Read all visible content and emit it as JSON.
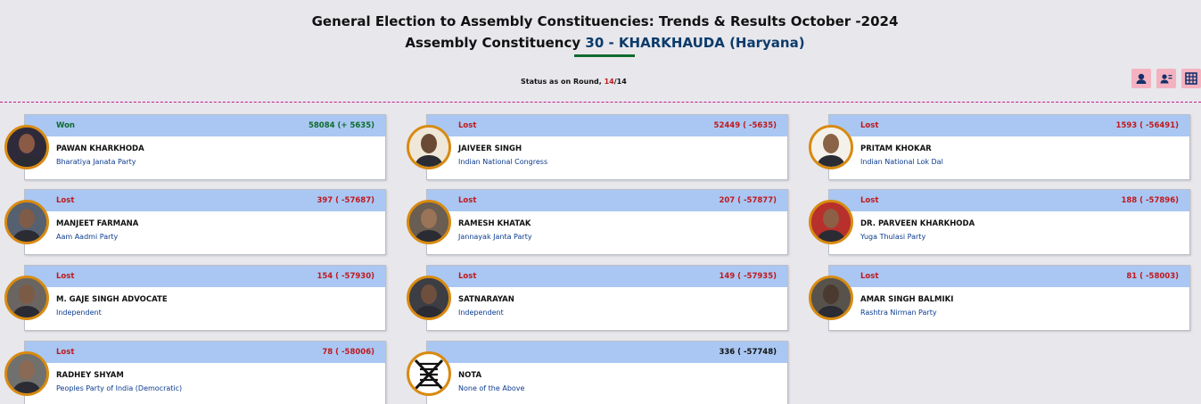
{
  "header": {
    "title_line1": "General Election to Assembly Constituencies: Trends & Results October -2024",
    "title_prefix": "Assembly Constituency ",
    "constituency": "30 - KHARKHAUDA",
    "state": "(Haryana)"
  },
  "status": {
    "label": "Status as on Round, ",
    "current_round": "14",
    "separator": "/",
    "total_rounds": "14"
  },
  "toolbar": {
    "icons": [
      "candidate-photo-icon",
      "person-list-icon",
      "table-grid-icon"
    ]
  },
  "candidates": [
    {
      "result": "Won",
      "votes": "58084 (+ 5635)",
      "name": "PAWAN KHARKHODA",
      "party": "Bharatiya Janata Party"
    },
    {
      "result": "Lost",
      "votes": "52449 ( -5635)",
      "name": "JAIVEER SINGH",
      "party": "Indian National Congress"
    },
    {
      "result": "Lost",
      "votes": "1593 ( -56491)",
      "name": "PRITAM KHOKAR",
      "party": "Indian National Lok Dal"
    },
    {
      "result": "Lost",
      "votes": "397 ( -57687)",
      "name": "MANJEET FARMANA",
      "party": "Aam Aadmi Party"
    },
    {
      "result": "Lost",
      "votes": "207 ( -57877)",
      "name": "RAMESH KHATAK",
      "party": "Jannayak Janta Party"
    },
    {
      "result": "Lost",
      "votes": "188 ( -57896)",
      "name": "DR. PARVEEN KHARKHODA",
      "party": "Yuga Thulasi Party"
    },
    {
      "result": "Lost",
      "votes": "154 ( -57930)",
      "name": "M. GAJE SINGH ADVOCATE",
      "party": "Independent"
    },
    {
      "result": "Lost",
      "votes": "149 ( -57935)",
      "name": "SATNARAYAN",
      "party": "Independent"
    },
    {
      "result": "Lost",
      "votes": "81 ( -58003)",
      "name": "AMAR SINGH BALMIKI",
      "party": "Rashtra Nirman Party"
    },
    {
      "result": "Lost",
      "votes": "78 ( -58006)",
      "name": "RADHEY SHYAM",
      "party": "Peoples Party of India (Democratic)"
    },
    {
      "result": "",
      "votes": "336 ( -57748)",
      "name": "NOTA",
      "party": "None of the Above"
    }
  ],
  "colors": {
    "won": "#0e6b2d",
    "lost": "#c0181d",
    "card_header": "#a9c7f2",
    "avatar_ring": "#d88a10",
    "divider": "#c41a8d"
  }
}
